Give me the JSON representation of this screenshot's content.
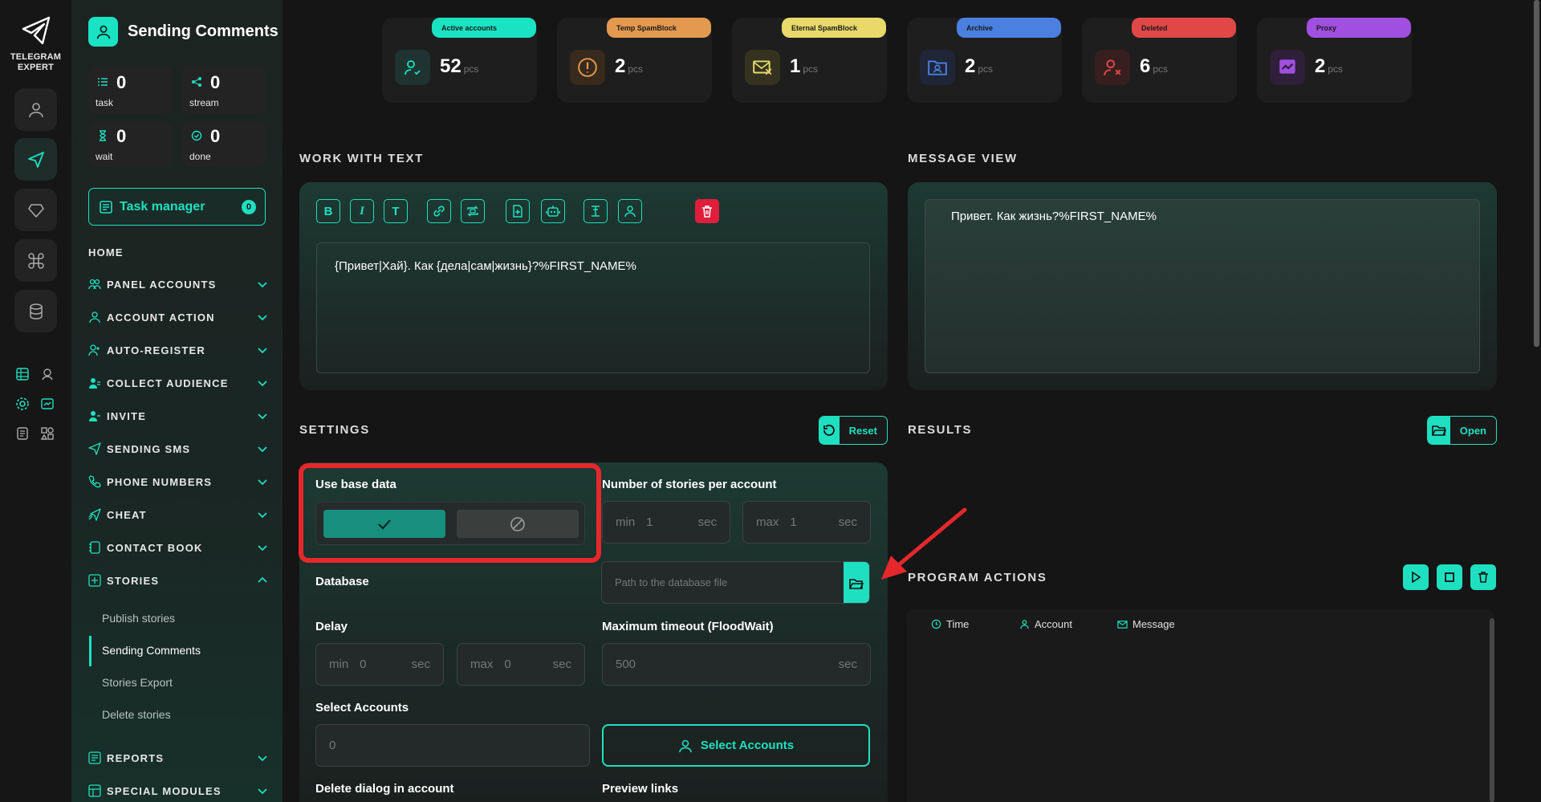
{
  "brand": {
    "name_line1": "TELEGRAM",
    "name_line2": "EXPERT"
  },
  "module": {
    "title": "Sending Comments"
  },
  "stats": [
    {
      "value": "0",
      "label": "task"
    },
    {
      "value": "0",
      "label": "stream"
    },
    {
      "value": "0",
      "label": "wait"
    },
    {
      "value": "0",
      "label": "done"
    }
  ],
  "task_manager": {
    "label": "Task manager",
    "count": "0"
  },
  "nav": {
    "home": "HOME",
    "items": [
      "PANEL ACCOUNTS",
      "ACCOUNT ACTION",
      "AUTO-REGISTER",
      "COLLECT AUDIENCE",
      "INVITE",
      "SENDING SMS",
      "PHONE NUMBERS",
      "CHEAT",
      "CONTACT BOOK",
      "STORIES"
    ],
    "stories_sub": [
      "Publish stories",
      "Sending Comments",
      "Stories Export",
      "Delete stories"
    ],
    "after": [
      "REPORTS",
      "SPECIAL MODULES"
    ]
  },
  "cards": [
    {
      "label": "Active accounts",
      "value": "52",
      "unit": "pcs",
      "color": "#19e3c3"
    },
    {
      "label": "Temp SpamBlock",
      "value": "2",
      "unit": "pcs",
      "color": "#e39a4f"
    },
    {
      "label": "Eternal SpamBlock",
      "value": "1",
      "unit": "pcs",
      "color": "#e8d96a"
    },
    {
      "label": "Archive",
      "value": "2",
      "unit": "pcs",
      "color": "#4b7fe0"
    },
    {
      "label": "Deleted",
      "value": "6",
      "unit": "pcs",
      "color": "#e04848"
    },
    {
      "label": "Proxy",
      "value": "2",
      "unit": "pcs",
      "color": "#a04fe0"
    }
  ],
  "sections": {
    "work_with_text": "WORK WITH TEXT",
    "message_view": "MESSAGE VIEW",
    "settings": "SETTINGS",
    "results": "RESULTS",
    "program_actions": "PROGRAM ACTIONS"
  },
  "editor": {
    "text": "{Привет|Хай}. Как {дела|сам|жизнь}?%FIRST_NAME%",
    "preview": "Привет. Как жизнь?%FIRST_NAME%",
    "tools": {
      "bold": "B",
      "italic": "I",
      "text": "T"
    }
  },
  "buttons": {
    "reset": "Reset",
    "open": "Open",
    "select_accounts": "Select Accounts"
  },
  "settings": {
    "use_base_data": "Use base data",
    "stories_per_account": "Number of stories per account",
    "stories_min": {
      "prefix": "min",
      "value": "1",
      "suffix": "sec"
    },
    "stories_max": {
      "prefix": "max",
      "value": "1",
      "suffix": "sec"
    },
    "database": "Database",
    "database_placeholder": "Path to the database file",
    "delay": "Delay",
    "delay_min": {
      "prefix": "min",
      "value": "0",
      "suffix": "sec"
    },
    "delay_max": {
      "prefix": "max",
      "value": "0",
      "suffix": "sec"
    },
    "max_timeout": "Maximum timeout (FloodWait)",
    "max_timeout_value": {
      "value": "500",
      "suffix": "sec"
    },
    "select_accounts": "Select Accounts",
    "select_accounts_value": "0",
    "delete_dialog": "Delete dialog in account",
    "preview_links": "Preview links"
  },
  "log": {
    "columns": [
      "Time",
      "Account",
      "Message"
    ]
  },
  "colors": {
    "accent": "#1ee0c0",
    "danger": "#e11d3c",
    "highlight": "#e5282c"
  }
}
